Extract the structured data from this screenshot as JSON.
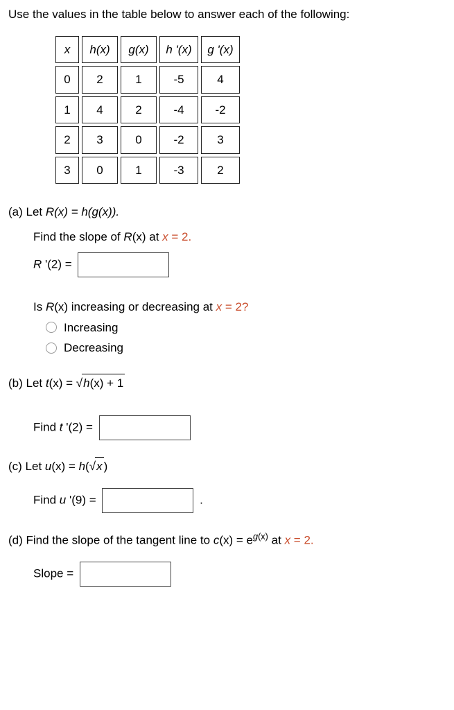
{
  "instruction": "Use the values in the table below to answer each of the following:",
  "table": {
    "headers": [
      "x",
      "h(x)",
      "g(x)",
      "h '(x)",
      "g '(x)"
    ],
    "rows": [
      [
        "0",
        "2",
        "1",
        "-5",
        "4"
      ],
      [
        "1",
        "4",
        "2",
        "-4",
        "-2"
      ],
      [
        "2",
        "3",
        "0",
        "-2",
        "3"
      ],
      [
        "3",
        "0",
        "1",
        "-3",
        "2"
      ]
    ]
  },
  "chart_data": {
    "type": "table",
    "columns": [
      "x",
      "h(x)",
      "g(x)",
      "h'(x)",
      "g'(x)"
    ],
    "rows": [
      [
        0,
        2,
        1,
        -5,
        4
      ],
      [
        1,
        4,
        2,
        -4,
        -2
      ],
      [
        2,
        3,
        0,
        -2,
        3
      ],
      [
        3,
        0,
        1,
        -3,
        2
      ]
    ]
  },
  "partA": {
    "label": "(a) Let ",
    "definition_R": "R",
    "definition_rest": "(x) = h(g(x)).",
    "find_prompt_pre": "Find the slope of ",
    "find_prompt_R": "R",
    "find_prompt_mid": "(x) at ",
    "find_prompt_x": "x",
    "find_prompt_eq": " = ",
    "find_prompt_val": "2.",
    "answer_label_R": "R ",
    "answer_label_rest": "'(2) =",
    "incdec_prompt_pre": "Is ",
    "incdec_prompt_R": "R",
    "incdec_prompt_mid": "(x) increasing or decreasing at ",
    "incdec_prompt_x": "x",
    "incdec_prompt_eq": " = ",
    "incdec_prompt_val": "2?",
    "option_inc": "Increasing",
    "option_dec": "Decreasing"
  },
  "partB": {
    "label": "(b) Let  ",
    "t": "t",
    "def_rest1": "(x) = ",
    "sqrt_sym": "√",
    "sqrt_inner_h": "h",
    "sqrt_inner_rest": "(x) + 1",
    "find_label_t": "t ",
    "find_label_rest": "'(2) =",
    "find_prefix": "Find "
  },
  "partC": {
    "label": "(c) Let  ",
    "u": "u",
    "def_rest1": "(x) = ",
    "h": "h",
    "paren_open": "(",
    "sqrt_sym": "√",
    "sqrt_inner": "x",
    "paren_close": ")",
    "find_prefix": "Find ",
    "find_label_u": "u ",
    "find_label_rest": "'(9) =",
    "period": "."
  },
  "partD": {
    "label": "(d) Find the slope of the tangent line to  ",
    "c": "c",
    "def_rest": "(x) = e",
    "exp_g": "g",
    "exp_rest": "(x)",
    "at": "  at ",
    "x": "x",
    "eq": " = ",
    "val": "2.",
    "slope_label": "Slope ="
  }
}
